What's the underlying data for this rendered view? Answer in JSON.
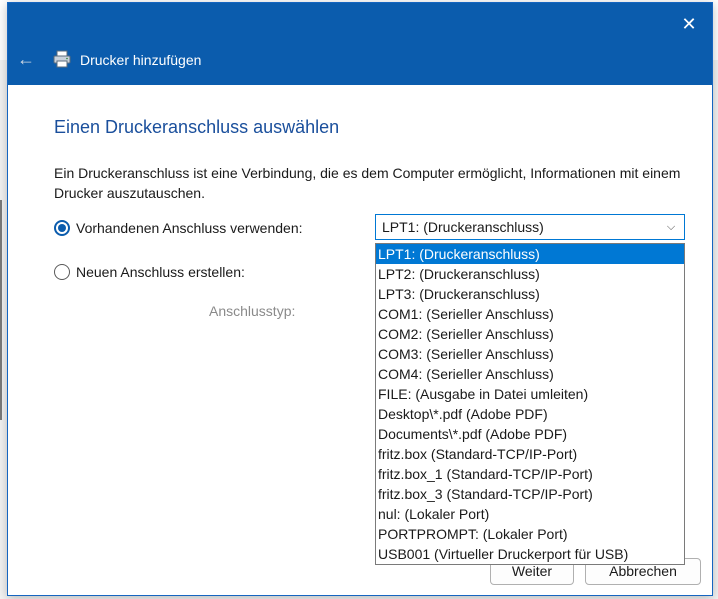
{
  "dialog": {
    "title": "Drucker hinzufügen",
    "heading": "Einen Druckeranschluss auswählen",
    "description": "Ein Druckeranschluss ist eine Verbindung, die es dem Computer ermöglicht, Informationen mit einem Drucker auszutauschen.",
    "close_glyph": "✕",
    "back_glyph": "←"
  },
  "options": {
    "existing_label": "Vorhandenen Anschluss verwenden:",
    "new_label": "Neuen Anschluss erstellen:",
    "port_type_label": "Anschlusstyp:",
    "selected": "existing"
  },
  "combo": {
    "value": "LPT1: (Druckeranschluss)",
    "chevron": "⌵"
  },
  "dropdown": {
    "items": [
      "LPT1: (Druckeranschluss)",
      "LPT2: (Druckeranschluss)",
      "LPT3: (Druckeranschluss)",
      "COM1: (Serieller Anschluss)",
      "COM2: (Serieller Anschluss)",
      "COM3: (Serieller Anschluss)",
      "COM4: (Serieller Anschluss)",
      "FILE: (Ausgabe in Datei umleiten)",
      "Desktop\\*.pdf (Adobe PDF)",
      "Documents\\*.pdf (Adobe PDF)",
      "fritz.box (Standard-TCP/IP-Port)",
      "fritz.box_1 (Standard-TCP/IP-Port)",
      "fritz.box_3 (Standard-TCP/IP-Port)",
      "nul: (Lokaler Port)",
      "PORTPROMPT: (Lokaler Port)",
      "USB001 (Virtueller Druckerport für USB)"
    ],
    "selected_index": 0
  },
  "buttons": {
    "next": "Weiter",
    "cancel": "Abbrechen"
  },
  "colors": {
    "titlebar": "#0b5cad",
    "heading": "#1a4f9c",
    "selection": "#0078d4"
  }
}
